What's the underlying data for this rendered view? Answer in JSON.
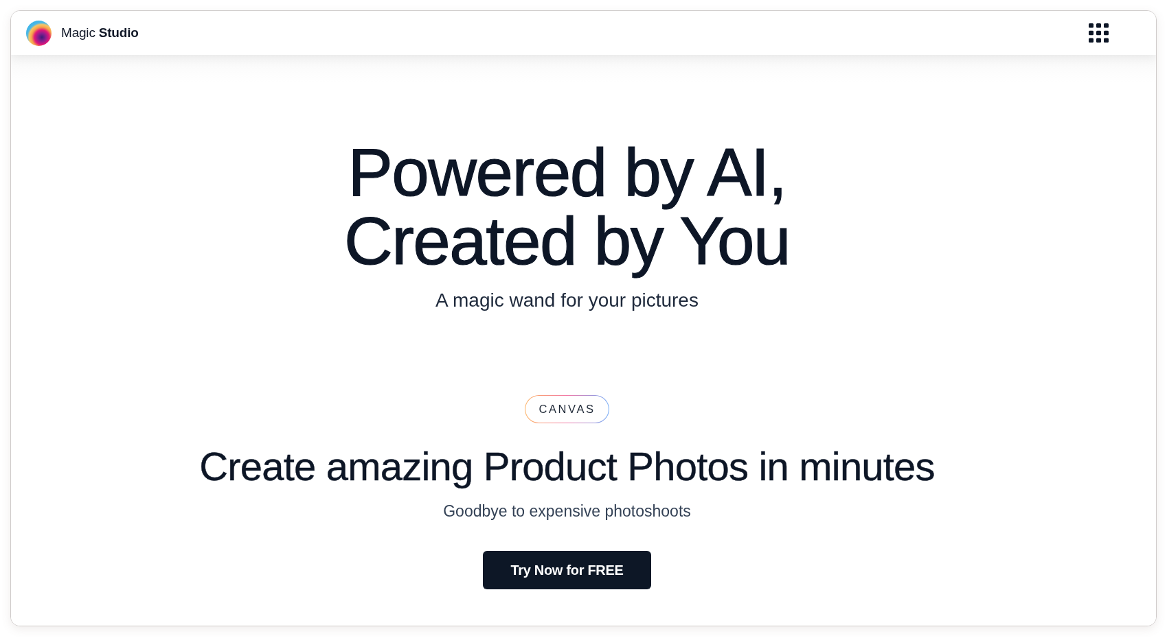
{
  "header": {
    "brand": "Magic **Studio**"
  },
  "hero": {
    "title_lines": [
      "Powered by AI,",
      "Created by You"
    ],
    "subtitle": "A magic wand for your pictures"
  },
  "feature": {
    "tag": "CANVAS",
    "heading": "Create amazing Product Photos in minutes",
    "subheading": "Goodbye to expensive photoshoots",
    "cta": "Try Now for FREE"
  }
}
